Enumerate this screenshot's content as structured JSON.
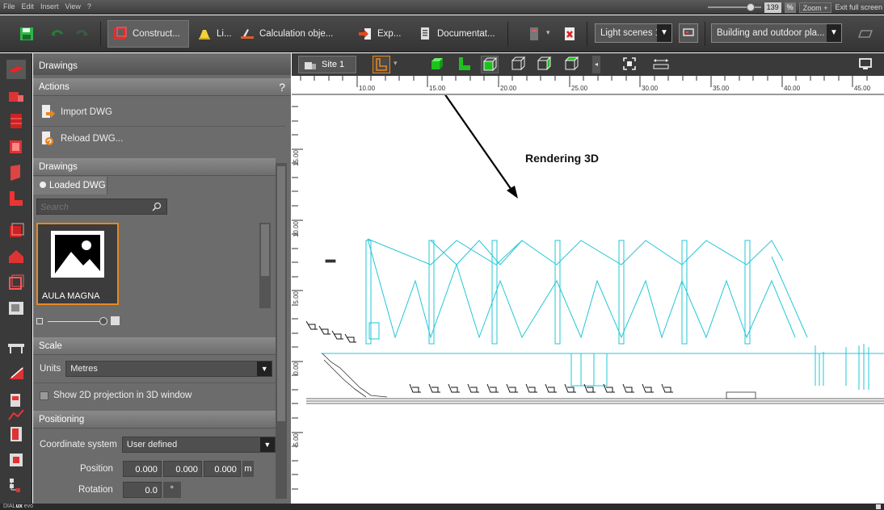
{
  "menubar": {
    "items": [
      "File",
      "Edit",
      "Insert",
      "View",
      "?"
    ],
    "zoom_value": "139",
    "zoom_unit": "%",
    "zoom_label": "Zoom",
    "zoom_arrow": "+",
    "exit_fullscreen": "Exit full screen"
  },
  "toolbar": {
    "construct": "Construct...",
    "light": "Li...",
    "calc": "Calculation obje...",
    "export": "Exp...",
    "documentation": "Documentat...",
    "light_scenes": "Light scenes 1",
    "building": "Building and outdoor pla..."
  },
  "panel": {
    "title": "Drawings",
    "actions_header": "Actions",
    "help": "?",
    "import_dwg": "Import DWG",
    "reload_dwg": "Reload DWG...",
    "drawings_header": "Drawings",
    "loaded_tab": "Loaded DWG",
    "search_placeholder": "Search",
    "drawing_name": "AULA MAGNA",
    "scale_header": "Scale",
    "units_label": "Units",
    "units_value": "Metres",
    "show_2d": "Show 2D projection in 3D window",
    "positioning_header": "Positioning",
    "coord_label": "Coordinate system",
    "coord_value": "User defined",
    "position_label": "Position",
    "pos_x": "0.000",
    "pos_y": "0.000",
    "pos_z": "0.000",
    "pos_unit": "m",
    "rotation_label": "Rotation",
    "rotation_value": "0.0",
    "rotation_unit": "°"
  },
  "canvas": {
    "site_label": "Site 1",
    "ruler_h": [
      "10.00",
      "15.00",
      "20.00",
      "25.00",
      "30.00",
      "35.00",
      "40.00",
      "45.00"
    ],
    "ruler_v": [
      "15.00",
      "10.00",
      "5.00",
      "0.00",
      "-5.00"
    ],
    "annotation": "Rendering 3D"
  },
  "status": {
    "brand_a": "DIAL",
    "brand_b": "ux",
    "brand_c": " evo"
  },
  "colors": {
    "accent_orange": "#e8881f",
    "green": "#1ec21e",
    "cyan_drawing": "#22c7d6"
  }
}
